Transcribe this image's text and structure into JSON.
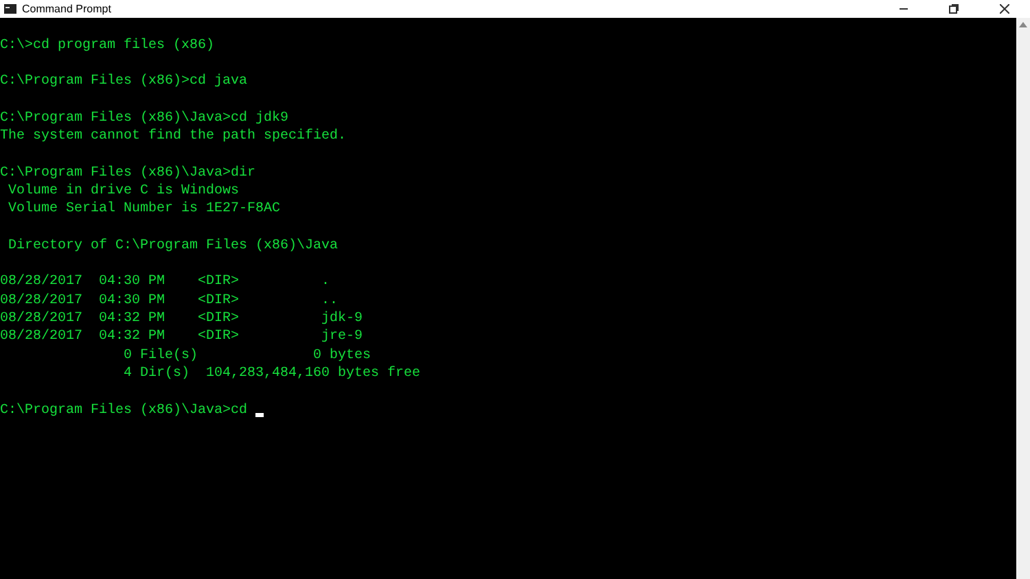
{
  "window": {
    "title": "Command Prompt"
  },
  "console": {
    "blocks": [
      [
        "C:\\>cd program files (x86)"
      ],
      [
        "C:\\Program Files (x86)>cd java"
      ],
      [
        "C:\\Program Files (x86)\\Java>cd jdk9",
        "The system cannot find the path specified."
      ],
      [
        "C:\\Program Files (x86)\\Java>dir",
        " Volume in drive C is Windows",
        " Volume Serial Number is 1E27-F8AC"
      ],
      [
        " Directory of C:\\Program Files (x86)\\Java"
      ],
      [
        "08/28/2017  04:30 PM    <DIR>          .",
        "08/28/2017  04:30 PM    <DIR>          ..",
        "08/28/2017  04:32 PM    <DIR>          jdk-9",
        "08/28/2017  04:32 PM    <DIR>          jre-9",
        "               0 File(s)              0 bytes",
        "               4 Dir(s)  104,283,484,160 bytes free"
      ],
      [
        "C:\\Program Files (x86)\\Java>cd "
      ]
    ]
  }
}
